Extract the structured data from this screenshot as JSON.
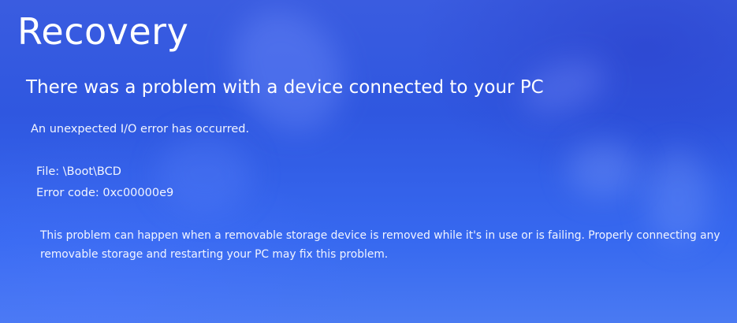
{
  "screen": {
    "title": "Recovery",
    "subtitle": "There was a problem with a device connected to your PC",
    "message": "An unexpected I/O error has occurred.",
    "file": "File: \\Boot\\BCD",
    "error_code": "Error code: 0xc00000e9",
    "description": "This problem can happen when a removable storage device is removed while it's in use or is failing. Properly connecting any removable storage and restarting your PC may fix this problem."
  },
  "colors": {
    "background": "#2f57e0",
    "text": "#ffffff"
  }
}
